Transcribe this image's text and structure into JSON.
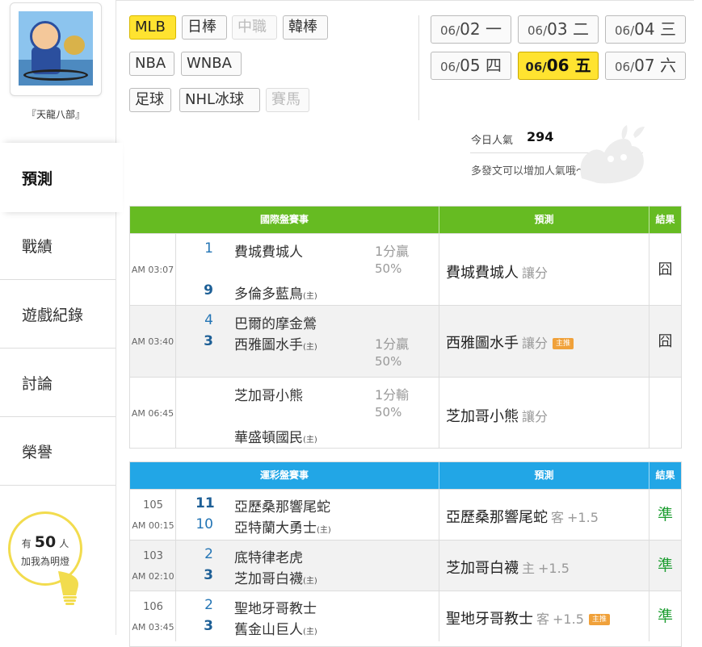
{
  "user": {
    "name": "『天龍八部』"
  },
  "nav": {
    "items": [
      {
        "label": "預測",
        "active": true
      },
      {
        "label": "戰績"
      },
      {
        "label": "遊戲紀錄"
      },
      {
        "label": "討論"
      },
      {
        "label": "榮譽"
      }
    ]
  },
  "fans": {
    "prefix": "有",
    "count": "50",
    "suffix": "人",
    "cta": "加我為明燈"
  },
  "sports": [
    {
      "label": "MLB",
      "state": "active"
    },
    {
      "label": "日棒",
      "state": "normal"
    },
    {
      "label": "中職",
      "state": "disabled"
    },
    {
      "label": "韓棒",
      "state": "normal"
    },
    {
      "label": "NBA",
      "state": "normal"
    },
    {
      "label": "WNBA",
      "state": "normal"
    },
    {
      "label": "足球",
      "state": "normal"
    },
    {
      "label": "NHL冰球",
      "state": "normal"
    },
    {
      "label": "賽馬",
      "state": "disabled"
    }
  ],
  "dates": [
    {
      "month": "06/",
      "day": "02",
      "weekday": "一",
      "active": false
    },
    {
      "month": "06/",
      "day": "03",
      "weekday": "二",
      "active": false
    },
    {
      "month": "06/",
      "day": "04",
      "weekday": "三",
      "active": false
    },
    {
      "month": "06/",
      "day": "05",
      "weekday": "四",
      "active": false
    },
    {
      "month": "06/",
      "day": "06",
      "weekday": "五",
      "active": true
    },
    {
      "month": "06/",
      "day": "07",
      "weekday": "六",
      "active": false
    }
  ],
  "popularity": {
    "label": "今日人氣",
    "value": "294",
    "tip": "多發文可以增加人氣哦～"
  },
  "international": {
    "header": {
      "match": "國際盤賽事",
      "prediction": "預測",
      "result": "結果"
    },
    "color": "#66bb22",
    "rows": [
      {
        "time": "AM 03:07",
        "away_rank": "1",
        "away": "費城費城人",
        "home_rank": "9",
        "home": "多倫多藍鳥",
        "home_tag": "(主)",
        "odds_line": "1分贏",
        "odds_pct": "50%",
        "odds_pos": "top",
        "pick": "費城費城人",
        "pick_type": "讓分",
        "badge": "",
        "result": "囧"
      },
      {
        "time": "AM 03:40",
        "away_rank": "4",
        "away": "巴爾的摩金鶯",
        "home_rank": "3",
        "home": "西雅圖水手",
        "home_tag": "(主)",
        "odds_line": "1分贏",
        "odds_pct": "50%",
        "odds_pos": "bottom",
        "pick": "西雅圖水手",
        "pick_type": "讓分",
        "badge": "主推",
        "result": "囧"
      },
      {
        "time": "AM 06:45",
        "away_rank": "",
        "away": "芝加哥小熊",
        "home_rank": "",
        "home": "華盛頓國民",
        "home_tag": "(主)",
        "odds_line": "1分輸",
        "odds_pct": "50%",
        "odds_pos": "top",
        "pick": "芝加哥小熊",
        "pick_type": "讓分",
        "badge": "",
        "result": ""
      }
    ]
  },
  "lottery": {
    "header": {
      "match": "運彩盤賽事",
      "prediction": "預測",
      "result": "結果"
    },
    "color": "#22a6e6",
    "rows": [
      {
        "code": "105",
        "time": "AM 00:15",
        "away_rank": "11",
        "away": "亞歷桑那響尾蛇",
        "home_rank": "10",
        "home": "亞特蘭大勇士",
        "home_tag": "(主)",
        "pick": "亞歷桑那響尾蛇",
        "pick_side": "客",
        "pick_line": "+1.5",
        "badge": "",
        "result": "準"
      },
      {
        "code": "103",
        "time": "AM 02:10",
        "away_rank": "2",
        "away": "底特律老虎",
        "home_rank": "3",
        "home": "芝加哥白襪",
        "home_tag": "(主)",
        "pick": "芝加哥白襪",
        "pick_side": "主",
        "pick_line": "+1.5",
        "badge": "",
        "result": "準"
      },
      {
        "code": "106",
        "time": "AM 03:45",
        "away_rank": "2",
        "away": "聖地牙哥教士",
        "home_rank": "3",
        "home": "舊金山巨人",
        "home_tag": "(主)",
        "pick": "聖地牙哥教士",
        "pick_side": "客",
        "pick_line": "+1.5",
        "badge": "主推",
        "result": "準"
      }
    ]
  }
}
